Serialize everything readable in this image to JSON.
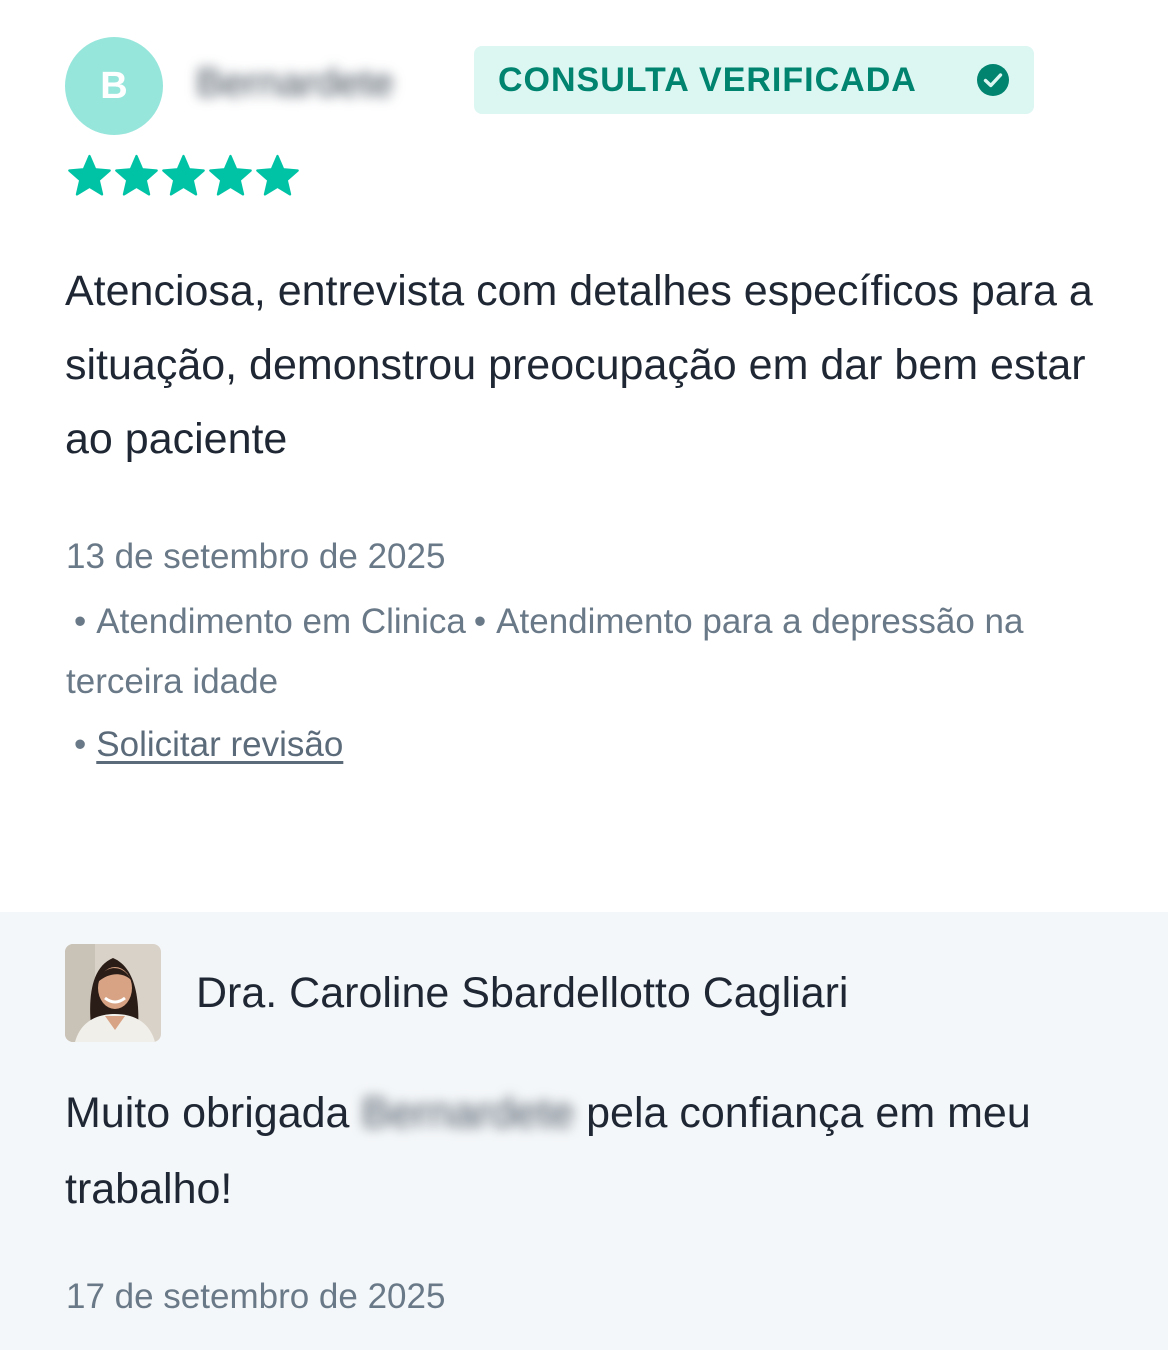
{
  "review": {
    "avatar_initial": "B",
    "patient_name": "Bernardete",
    "badge_label": "CONSULTA VERIFICADA",
    "rating": 5,
    "rating_max": 5,
    "text": "Atenciosa, entrevista com detalhes específicos para a situação, demonstrou preocupação em dar bem estar ao paciente",
    "date": "13 de setembro de 2025",
    "meta_items": [
      "Atendimento em Clinica",
      "Atendimento para a depressão na terceira idade"
    ],
    "request_review_link": "Solicitar revisão"
  },
  "reply": {
    "doctor_name": "Dra. Caroline Sbardellotto Cagliari",
    "text_before_name": "Muito obrigada",
    "blurred_name": "Bernardete",
    "text_after_name": "pela confiança em meu trabalho!",
    "date": "17 de setembro de 2025"
  },
  "colors": {
    "accent": "#00c3a5",
    "badge_bg": "#dcf6f2",
    "badge_text": "#00836f",
    "avatar_bg": "#97e6dc",
    "reply_bg": "#f4f7f9",
    "muted_text": "#6a7987"
  },
  "icons": {
    "badge": "check-circle-icon",
    "rating": "star-icon"
  }
}
